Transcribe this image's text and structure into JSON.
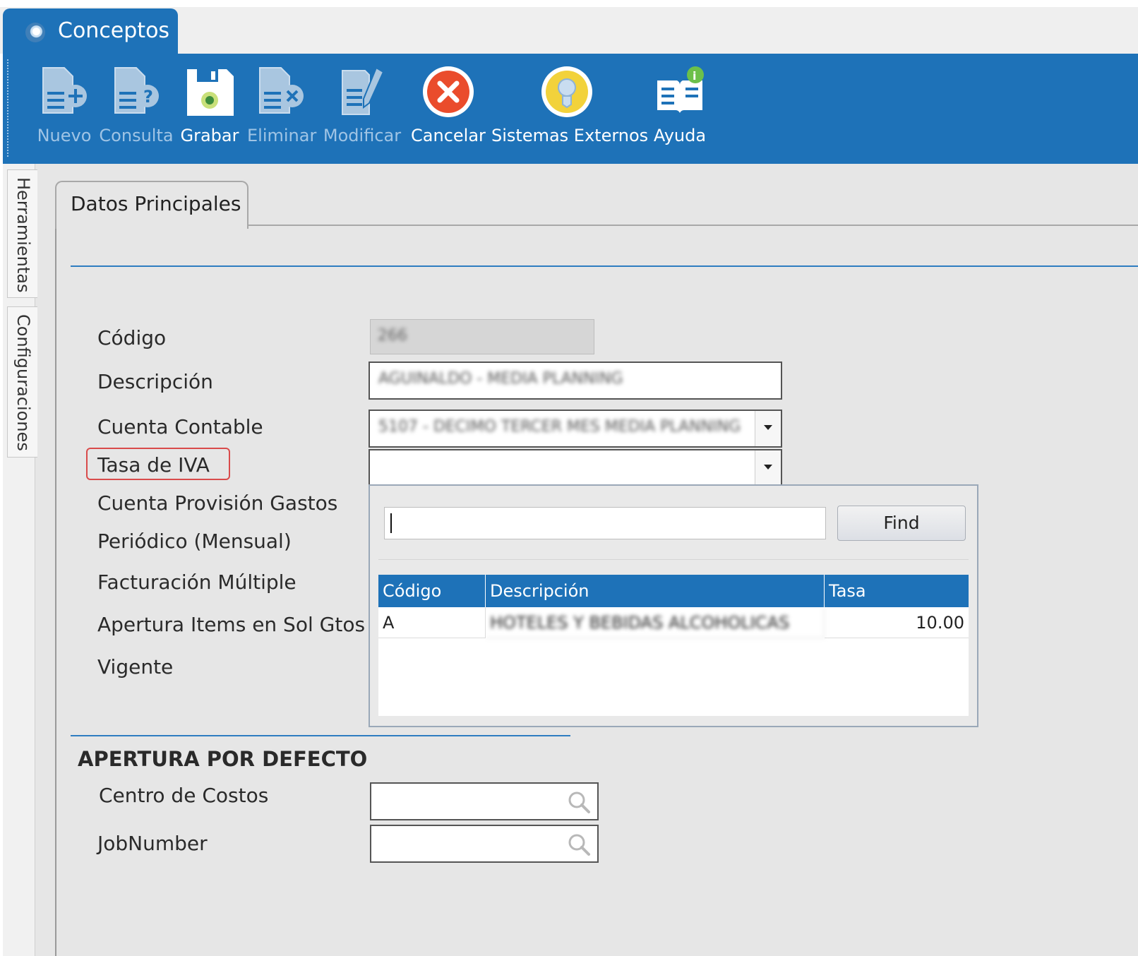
{
  "window": {
    "tab_title": "Conceptos",
    "tab_icon": "app-logo-icon"
  },
  "toolbar": {
    "buttons": [
      {
        "label": "Nuevo",
        "icon": "document-add-icon",
        "enabled": false
      },
      {
        "label": "Consulta",
        "icon": "document-query-icon",
        "enabled": false
      },
      {
        "label": "Grabar",
        "icon": "save-icon",
        "enabled": true
      },
      {
        "label": "Eliminar",
        "icon": "document-delete-icon",
        "enabled": false
      },
      {
        "label": "Modificar",
        "icon": "document-edit-icon",
        "enabled": false
      },
      {
        "label": "Cancelar",
        "icon": "cancel-icon",
        "enabled": true
      },
      {
        "label": "Sistemas Externos",
        "icon": "external-systems-icon",
        "enabled": true
      },
      {
        "label": "Ayuda",
        "icon": "help-book-icon",
        "enabled": true
      }
    ]
  },
  "side_tabs": [
    "Herramientas",
    "Configuraciones"
  ],
  "main_tab": "Datos Principales",
  "form": {
    "labels": {
      "codigo": "Código",
      "descripcion": "Descripción",
      "cuenta_contable": "Cuenta Contable",
      "tasa_iva": "Tasa de IVA",
      "cuenta_provision": "Cuenta Provisión Gastos",
      "periodico": "Periódico (Mensual)",
      "facturacion": "Facturación Múltiple",
      "apertura_items": "Apertura Items en Sol Gtos",
      "vigente": "Vigente"
    },
    "values": {
      "codigo": "266",
      "descripcion": "AGUINALDO - MEDIA PLANNING",
      "cuenta_contable": "5107 - DECIMO TERCER MES MEDIA PLANNING",
      "tasa_iva": ""
    }
  },
  "iva_dropdown": {
    "search_value": "",
    "find_label": "Find",
    "columns": [
      "Código",
      "Descripción",
      "Tasa"
    ],
    "rows": [
      {
        "codigo": "A",
        "descripcion": "HOTELES Y BEBIDAS ALCOHOLICAS",
        "tasa": "10.00"
      }
    ]
  },
  "apertura": {
    "title": "APERTURA POR DEFECTO",
    "centro_costos_label": "Centro de Costos",
    "jobnumber_label": "JobNumber"
  },
  "colors": {
    "primary": "#1e72b8",
    "highlight": "#d94b4b",
    "separator": "#2e7dc1"
  }
}
